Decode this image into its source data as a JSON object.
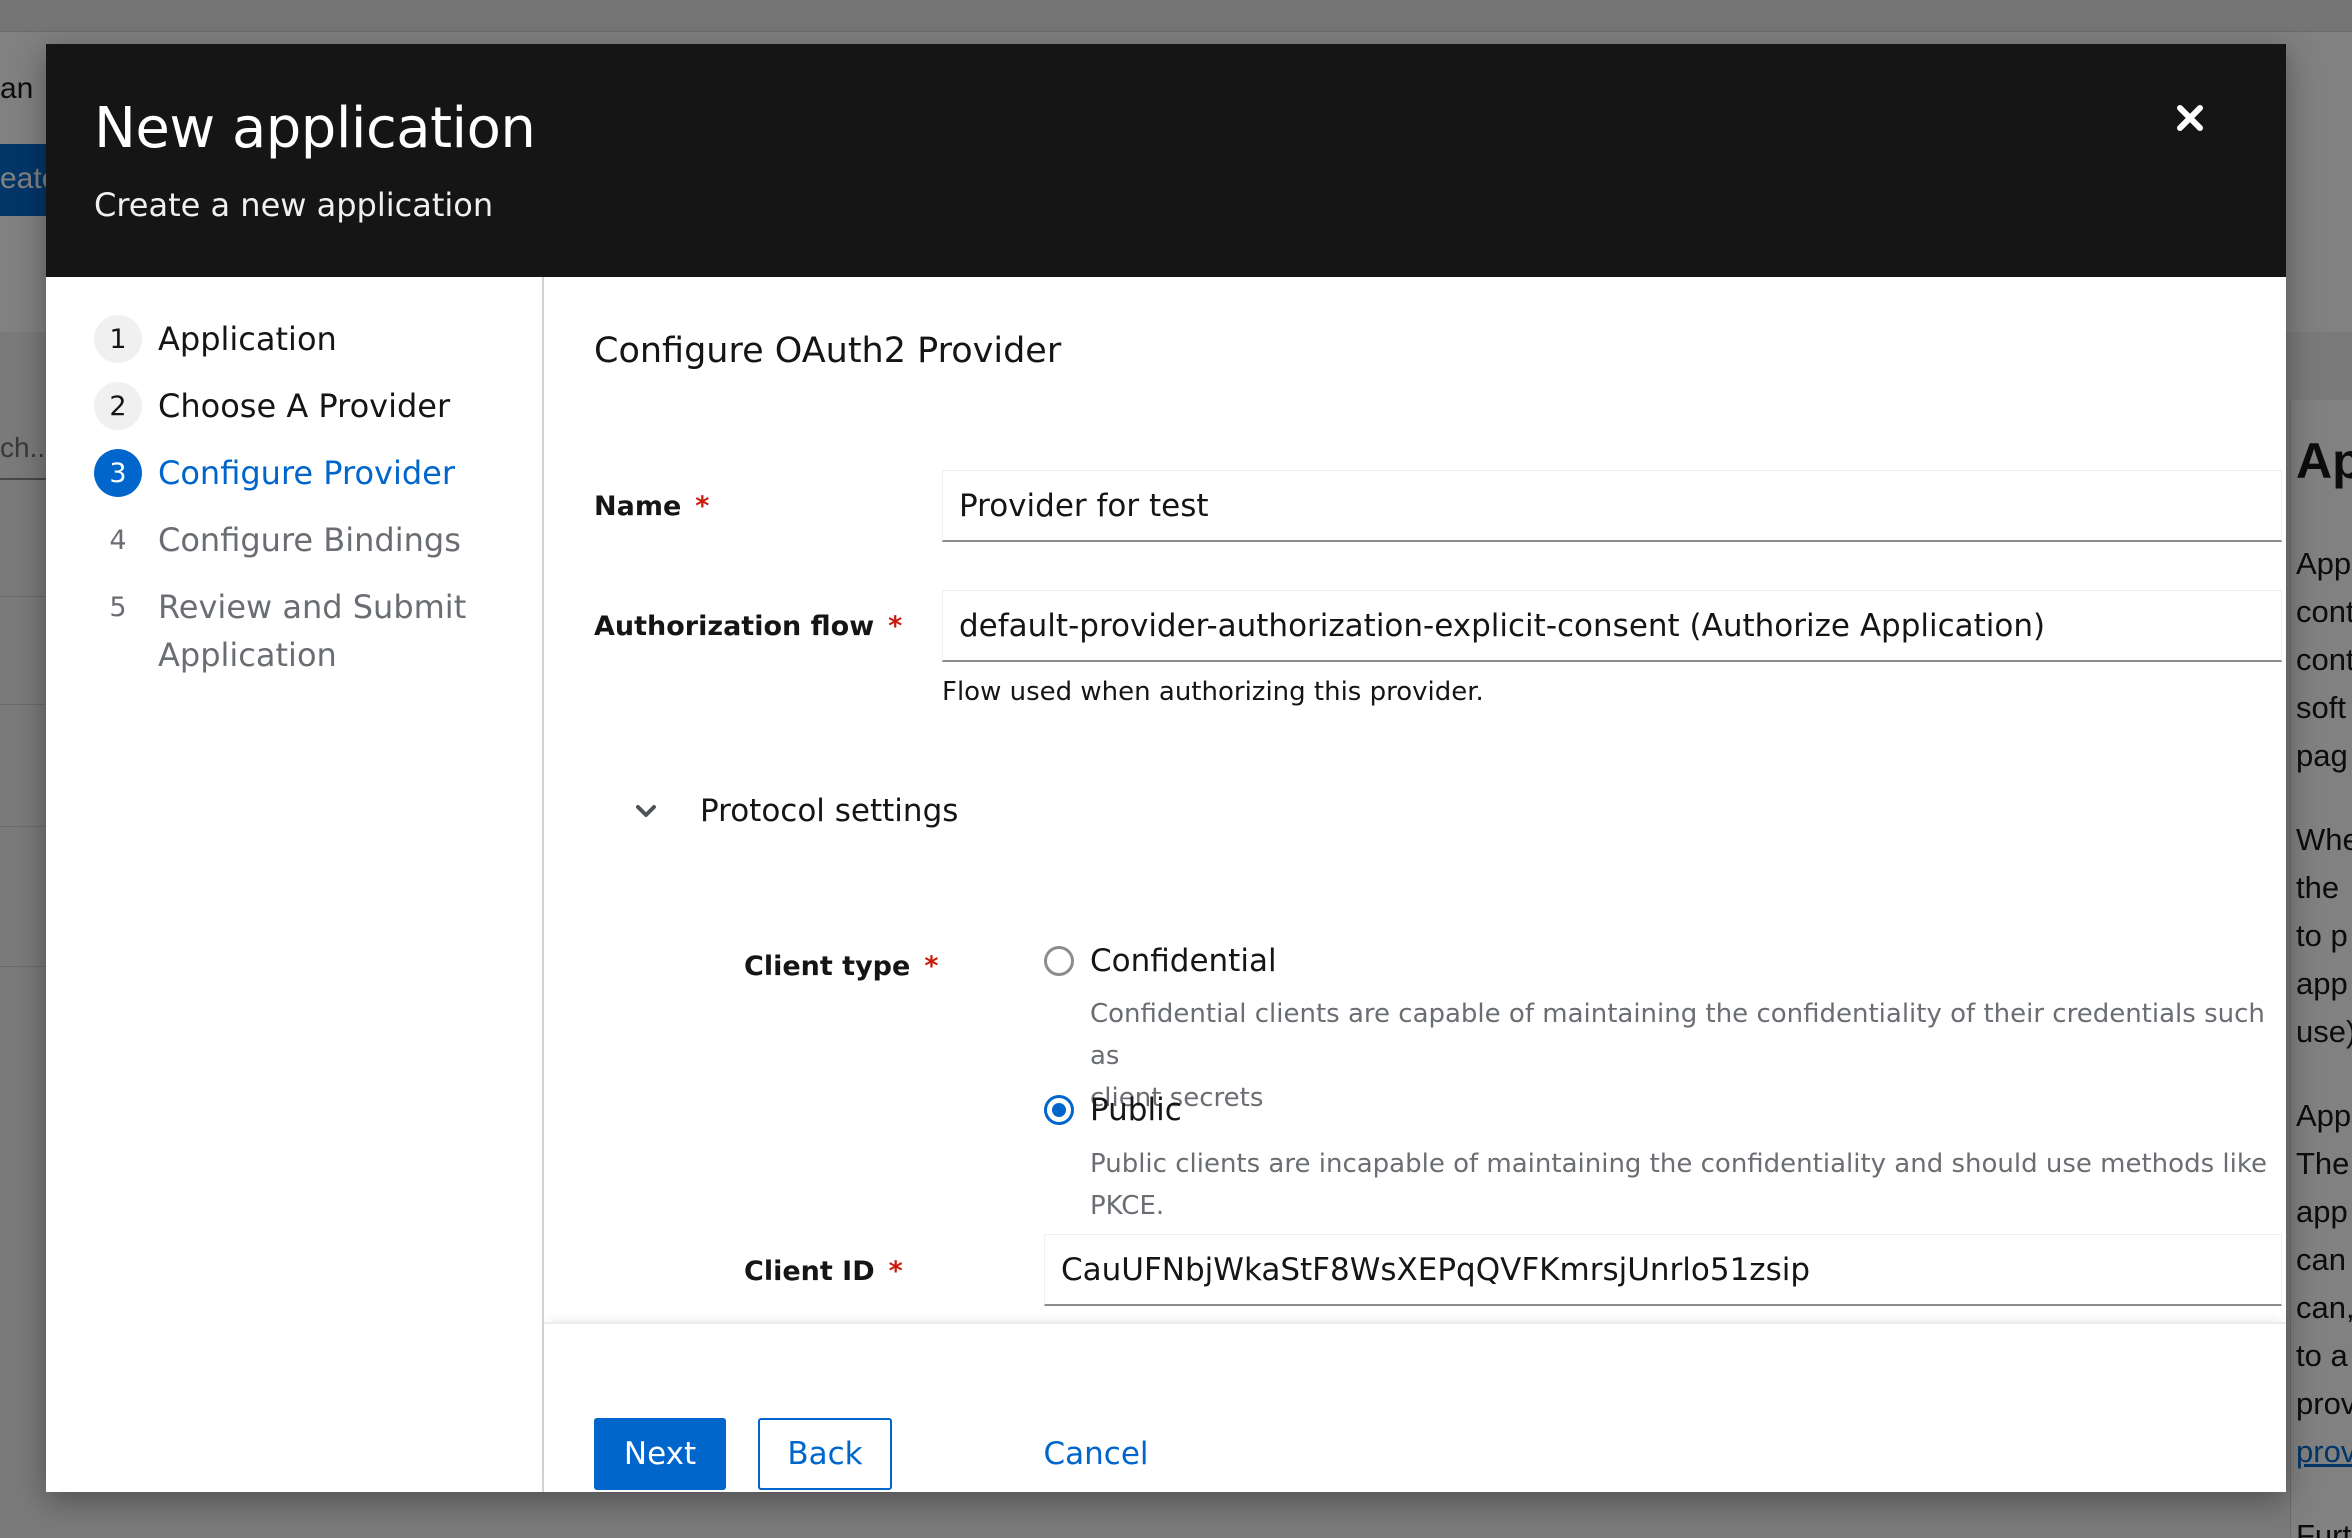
{
  "background": {
    "partial_text_left": "an",
    "partial_button_left": "eate",
    "partial_search_left": "ch...",
    "right_panel_title": "Ap",
    "right_panel_lines": [
      "App",
      "cont",
      "cont",
      "soft",
      "pag",
      "",
      "Whe",
      "the",
      "to p",
      "app",
      "use)",
      "",
      "App",
      "The",
      "app",
      "can",
      "can,",
      "to a",
      "prov",
      "prov",
      "",
      "Furt"
    ]
  },
  "modal": {
    "title": "New application",
    "subtitle": "Create a new application",
    "close_icon": "times-icon"
  },
  "wizard_nav": {
    "steps": [
      {
        "number": "1",
        "label": "Application",
        "state": "done"
      },
      {
        "number": "2",
        "label": "Choose A Provider",
        "state": "done"
      },
      {
        "number": "3",
        "label": "Configure Provider",
        "state": "current"
      },
      {
        "number": "4",
        "label": "Configure Bindings",
        "state": "future"
      },
      {
        "number": "5",
        "label": "Review and Submit Application",
        "state": "future"
      }
    ]
  },
  "form": {
    "section_title": "Configure OAuth2 Provider",
    "name": {
      "label": "Name",
      "required_mark": "*",
      "value": "Provider for test"
    },
    "authorization_flow": {
      "label": "Authorization flow",
      "required_mark": "*",
      "value": "default-provider-authorization-explicit-consent (Authorize Application)",
      "helper": "Flow used when authorizing this provider."
    },
    "protocol_settings": {
      "label": "Protocol settings",
      "expanded": true,
      "client_type": {
        "label": "Client type",
        "required_mark": "*",
        "options": [
          {
            "label": "Confidential",
            "description_line1": "Confidential clients are capable of maintaining the confidentiality of their credentials such as",
            "description_line2": "client secrets",
            "checked": false
          },
          {
            "label": "Public",
            "description_line1": "Public clients are incapable of maintaining the confidentiality and should use methods like PKCE.",
            "checked": true
          }
        ]
      },
      "client_id": {
        "label": "Client ID",
        "required_mark": "*",
        "value": "CauUFNbjWkaStF8WsXEPqQVFKmrsjUnrlo51zsip"
      }
    }
  },
  "footer": {
    "next_label": "Next",
    "back_label": "Back",
    "cancel_label": "Cancel"
  },
  "colors": {
    "primary": "#0066cc",
    "header_bg": "#151515",
    "required": "#c9190b",
    "muted_text": "#6a6e73"
  }
}
